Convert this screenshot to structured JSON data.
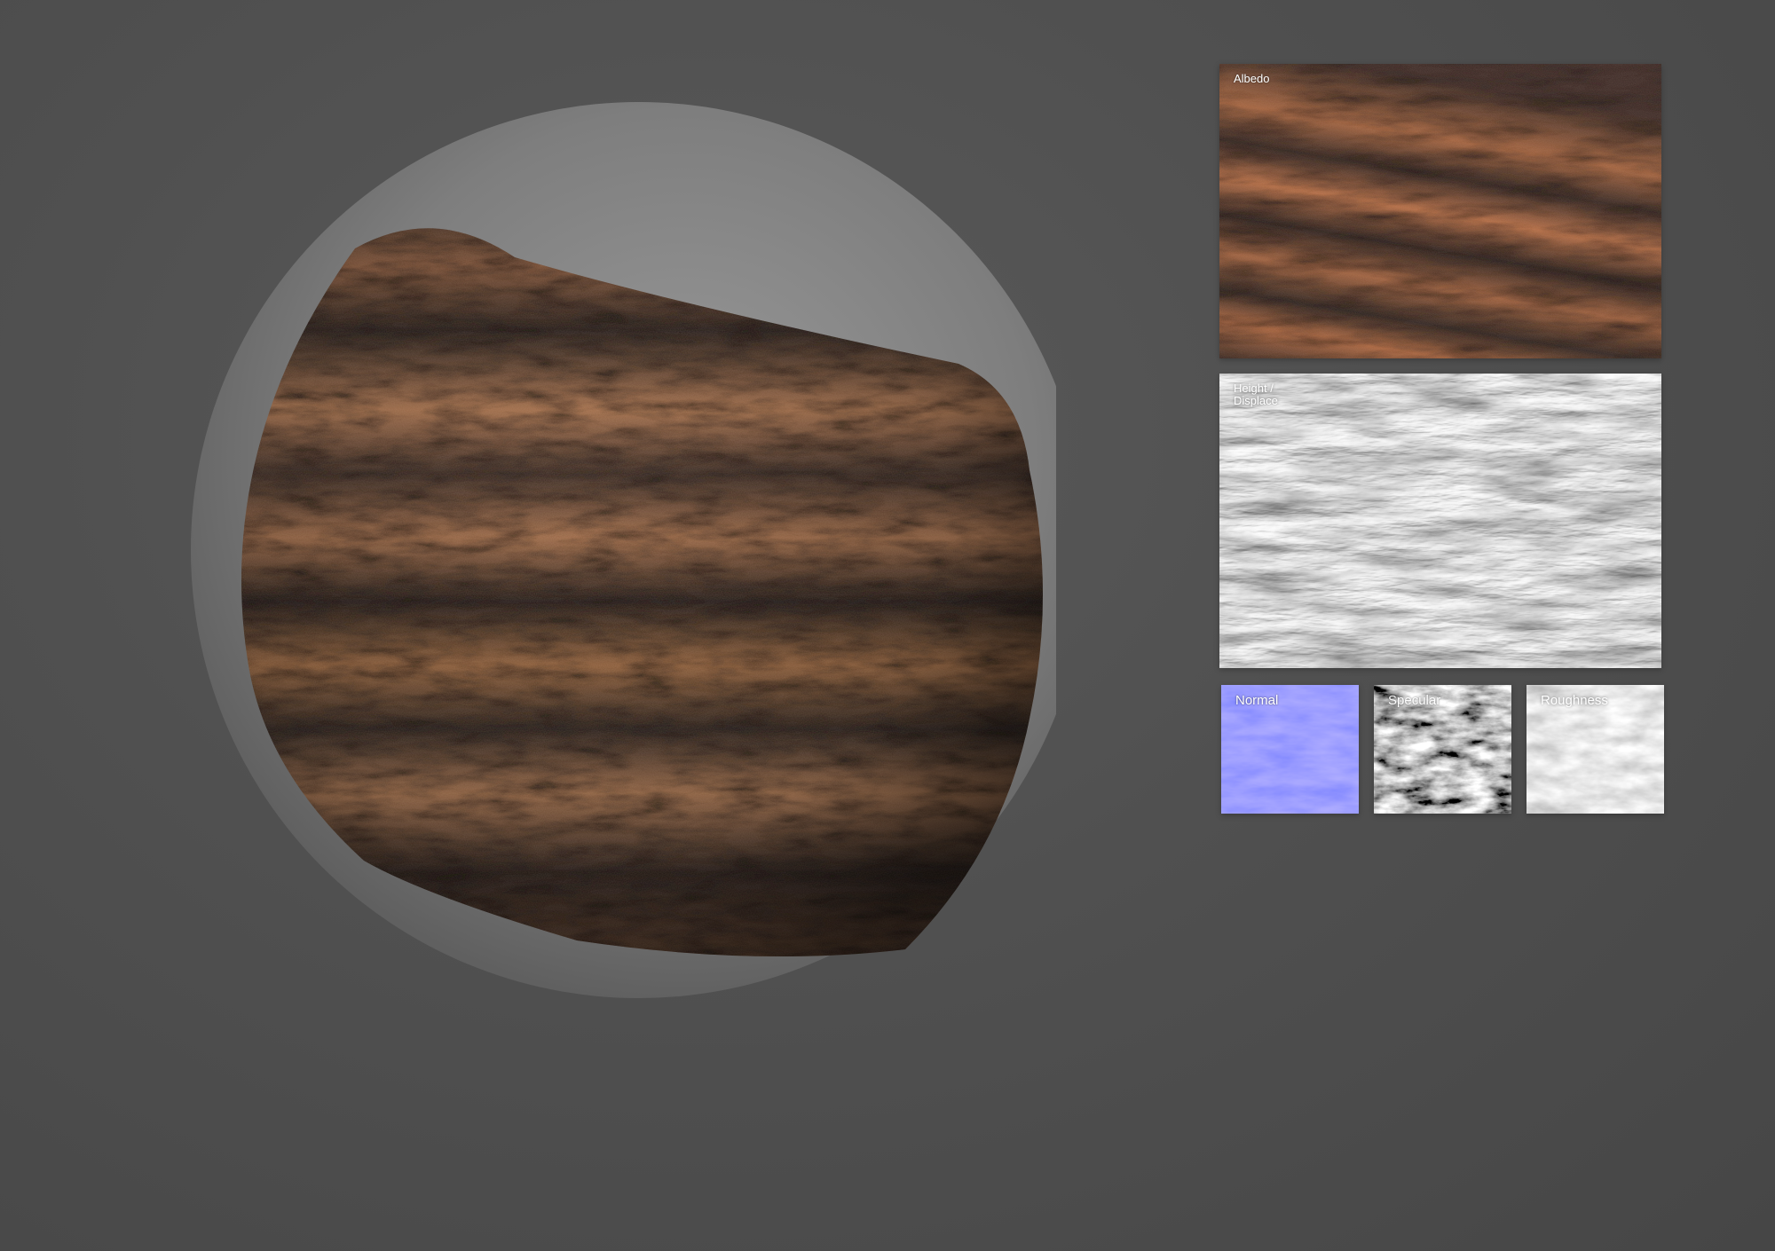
{
  "maps": {
    "albedo": {
      "label": "Albedo"
    },
    "height": {
      "label": "Height /\nDisplace"
    },
    "normal": {
      "label": "Normal",
      "tint": "#7a7cff"
    },
    "specular": {
      "label": "Specular"
    },
    "roughness": {
      "label": "Roughness"
    }
  },
  "colors": {
    "background": "#4e4e4e",
    "bark_dark": "#2b2320",
    "bark_light": "#a8734f",
    "sphere_grey": "#8c8c8c"
  }
}
